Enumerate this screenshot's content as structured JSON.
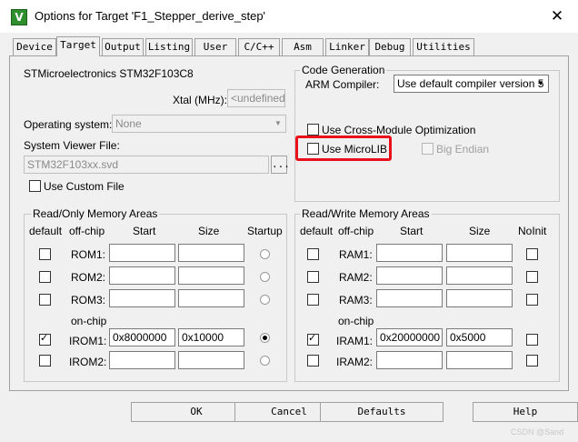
{
  "window": {
    "title": "Options for Target 'F1_Stepper_derive_step'",
    "app_icon_text": "V",
    "close_glyph": "✕"
  },
  "tabs": [
    {
      "label": "Device"
    },
    {
      "label": "Target"
    },
    {
      "label": "Output"
    },
    {
      "label": "Listing"
    },
    {
      "label": "User"
    },
    {
      "label": "C/C++"
    },
    {
      "label": "Asm"
    },
    {
      "label": "Linker"
    },
    {
      "label": "Debug"
    },
    {
      "label": "Utilities"
    }
  ],
  "active_tab": "Target",
  "target": {
    "device_name": "STMicroelectronics STM32F103C8",
    "xtal_label": "Xtal (MHz):",
    "xtal_value": "<undefined>",
    "os_label": "Operating system:",
    "os_value": "None",
    "svd_label": "System Viewer File:",
    "svd_value": "STM32F103xx.svd",
    "browse_label": "...",
    "custom_file_label": "Use Custom File"
  },
  "codegen": {
    "legend": "Code Generation",
    "compiler_label": "ARM Compiler:",
    "compiler_value": "Use default compiler version 5",
    "cross_module_label": "Use Cross-Module Optimization",
    "microlib_label": "Use MicroLIB",
    "big_endian_label": "Big Endian"
  },
  "rom": {
    "legend": "Read/Only Memory Areas",
    "headers": {
      "default": "default",
      "offchip": "off-chip",
      "start": "Start",
      "size": "Size",
      "last": "Startup"
    },
    "onchip_label": "on-chip",
    "rows": [
      {
        "name": "ROM1:",
        "start": "",
        "size": "",
        "default": false,
        "selected": false
      },
      {
        "name": "ROM2:",
        "start": "",
        "size": "",
        "default": false,
        "selected": false
      },
      {
        "name": "ROM3:",
        "start": "",
        "size": "",
        "default": false,
        "selected": false
      },
      {
        "name": "IROM1:",
        "start": "0x8000000",
        "size": "0x10000",
        "default": true,
        "selected": true
      },
      {
        "name": "IROM2:",
        "start": "",
        "size": "",
        "default": false,
        "selected": false
      }
    ]
  },
  "ram": {
    "legend": "Read/Write Memory Areas",
    "headers": {
      "default": "default",
      "offchip": "off-chip",
      "start": "Start",
      "size": "Size",
      "last": "NoInit"
    },
    "onchip_label": "on-chip",
    "rows": [
      {
        "name": "RAM1:",
        "start": "",
        "size": "",
        "default": false,
        "noinit": false
      },
      {
        "name": "RAM2:",
        "start": "",
        "size": "",
        "default": false,
        "noinit": false
      },
      {
        "name": "RAM3:",
        "start": "",
        "size": "",
        "default": false,
        "noinit": false
      },
      {
        "name": "IRAM1:",
        "start": "0x20000000",
        "size": "0x5000",
        "default": true,
        "noinit": false
      },
      {
        "name": "IRAM2:",
        "start": "",
        "size": "",
        "default": false,
        "noinit": false
      }
    ]
  },
  "buttons": {
    "ok": "OK",
    "cancel": "Cancel",
    "defaults": "Defaults",
    "help": "Help"
  },
  "watermark": "CSDN @Sand",
  "colors": {
    "highlight": "#e8101a",
    "panel_bg": "#f0f0f0"
  }
}
